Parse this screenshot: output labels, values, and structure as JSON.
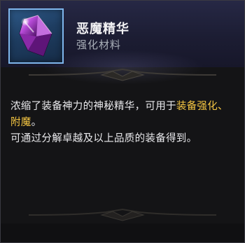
{
  "item": {
    "name": "恶魔精华",
    "type": "强化材料",
    "icon": "purple-crystal-icon"
  },
  "description": {
    "line1_prefix": "浓缩了装备神力的神秘精华，可用于",
    "line1_highlight": "装备强化、附魔",
    "line1_suffix": "。",
    "line2": "可通过分解卓越及以上品质的装备得到。"
  },
  "colors": {
    "highlight": "#f4c542",
    "icon_frame_border": "#7fb6ec",
    "header_bg": "#262845",
    "panel_bg": "#141416"
  }
}
